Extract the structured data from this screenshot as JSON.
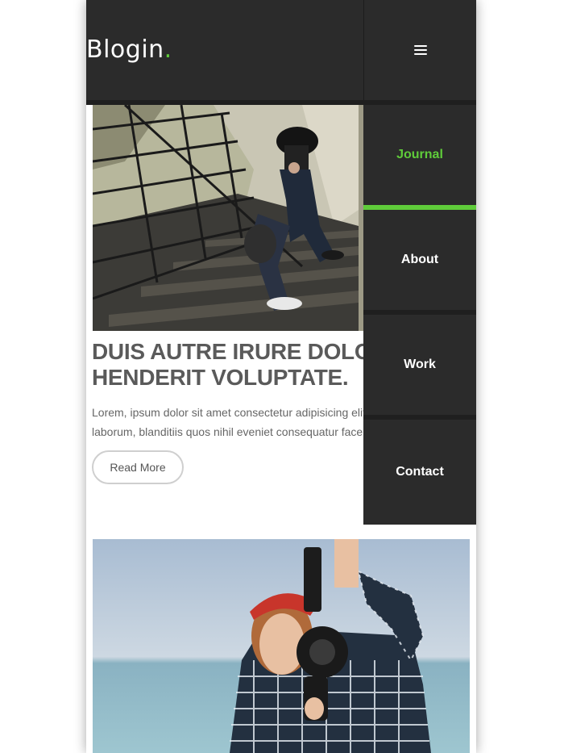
{
  "brand": {
    "logo_text": "Blogin",
    "logo_dot": ".",
    "accent": "#5fcc3a",
    "dark": "#2b2b2b"
  },
  "menu": {
    "toggle_icon": "hamburger-icon",
    "items": [
      {
        "label": "Journal",
        "active": true
      },
      {
        "label": "About",
        "active": false
      },
      {
        "label": "Work",
        "active": false
      },
      {
        "label": "Contact",
        "active": false
      }
    ]
  },
  "posts": [
    {
      "image": "woman-sitting-on-metal-stairs-photo",
      "title": "DUIS AUTRE IRURE DOLOR\nHENDERIT VOLUPTATE.",
      "excerpt": "Lorem, ipsum dolor sit amet consectetur adipisicing elit.\nlaborum, blanditiis quos nihil eveniet consequatur facere",
      "read_more_label": "Read More"
    },
    {
      "image": "woman-with-film-camera-photo"
    }
  ]
}
